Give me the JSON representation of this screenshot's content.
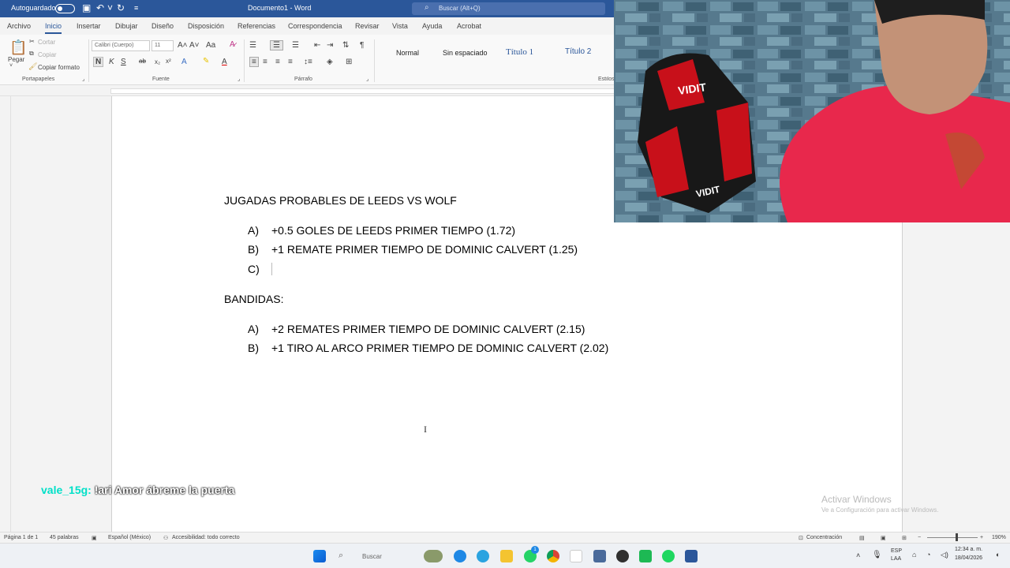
{
  "titlebar": {
    "autosave_label": "Autoguardado",
    "document_title": "Documento1  -  Word",
    "search_placeholder": "Buscar (Alt+Q)"
  },
  "tabs": [
    "Archivo",
    "Inicio",
    "Insertar",
    "Dibujar",
    "Diseño",
    "Disposición",
    "Referencias",
    "Correspondencia",
    "Revisar",
    "Vista",
    "Ayuda",
    "Acrobat"
  ],
  "ribbon": {
    "clipboard": {
      "paste": "Pegar",
      "cut": "Cortar",
      "copy": "Copiar",
      "format_painter": "Copiar formato",
      "group": "Portapapeles"
    },
    "font": {
      "font_name": "Calibri (Cuerpo)",
      "font_size": "11",
      "group": "Fuente"
    },
    "paragraph": {
      "group": "Párrafo"
    },
    "styles": {
      "normal": "Normal",
      "no_spacing": "Sin espaciado",
      "heading1": "Título 1",
      "heading2": "Título 2",
      "group": "Estilos"
    }
  },
  "document": {
    "title": "JUGADAS PROBABLES DE LEEDS VS WOLF",
    "list1": [
      {
        "label": "A)",
        "text": "+0.5 GOLES DE LEEDS PRIMER TIEMPO (1.72)"
      },
      {
        "label": "B)",
        "text": "+1 REMATE PRIMER TIEMPO DE DOMINIC CALVERT (1.25)"
      },
      {
        "label": "C)",
        "text": ""
      }
    ],
    "subtitle": "BANDIDAS:",
    "list2": [
      {
        "label": "A)",
        "text": "+2 REMATES PRIMER TIEMPO DE DOMINIC CALVERT (2.15)"
      },
      {
        "label": "B)",
        "text": "+1 TIRO AL ARCO PRIMER TIEMPO DE DOMINIC CALVERT (2.02)"
      }
    ]
  },
  "overlay": {
    "chat_user": "vale_15g:",
    "chat_message": "!ari Amor ábreme la puerta",
    "activate_title": "Activar Windows",
    "activate_sub": "Ve a Configuración para activar Windows."
  },
  "statusbar": {
    "page": "Página 1 de 1",
    "words": "45 palabras",
    "language": "Español (México)",
    "accessibility": "Accesibilidad: todo correcto",
    "focus": "Concentración",
    "zoom": "190%"
  },
  "taskbar": {
    "search_placeholder": "Buscar",
    "lang_top": "ESP",
    "lang_bottom": "LAA",
    "time": "12:34 a. m.",
    "date": "18/04/2026",
    "badge": "1"
  },
  "webcam": {
    "chair_brand": "VIDIT"
  },
  "colors": {
    "word_blue": "#2b579a",
    "chat_user": "#00e0c8"
  }
}
